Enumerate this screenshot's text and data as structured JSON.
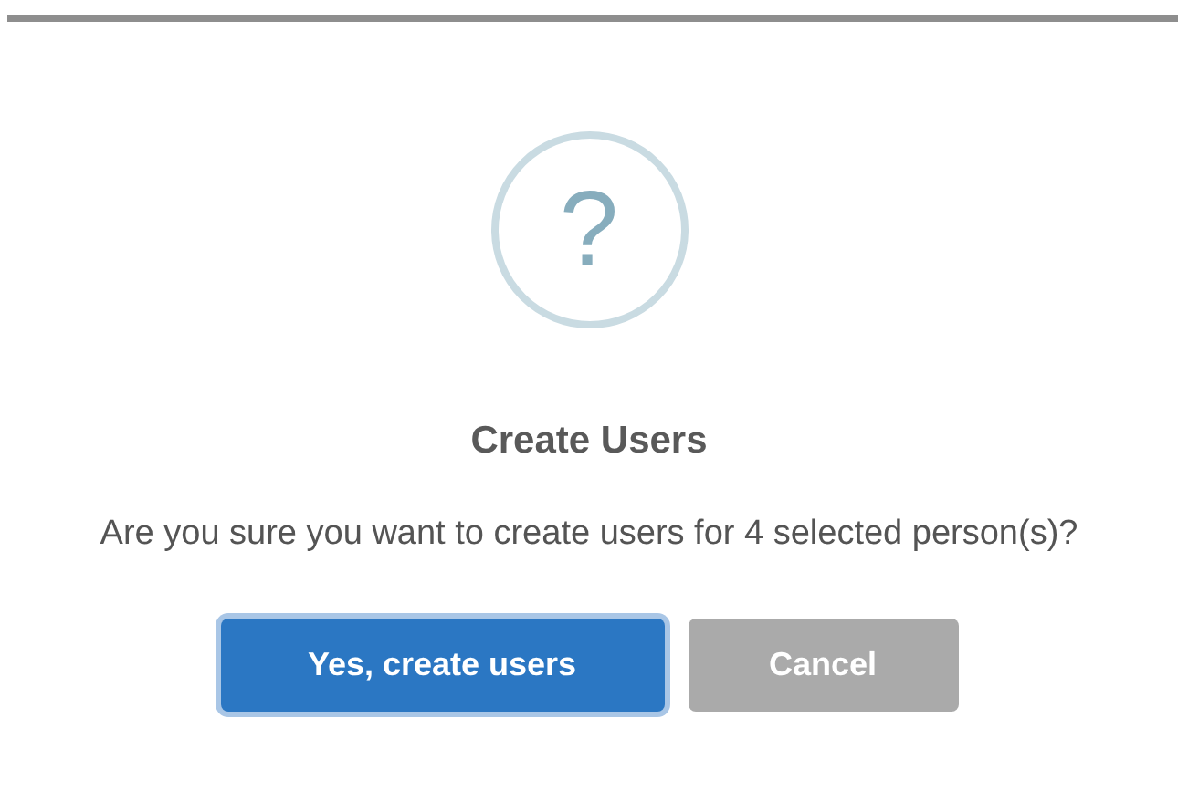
{
  "dialog": {
    "icon": "?",
    "title": "Create Users",
    "message": "Are you sure you want to create users for 4 selected person(s)?",
    "buttons": [
      {
        "label": "Yes, create users",
        "kind": "confirm",
        "focused": true
      },
      {
        "label": "Cancel",
        "kind": "cancel",
        "focused": false
      }
    ]
  }
}
